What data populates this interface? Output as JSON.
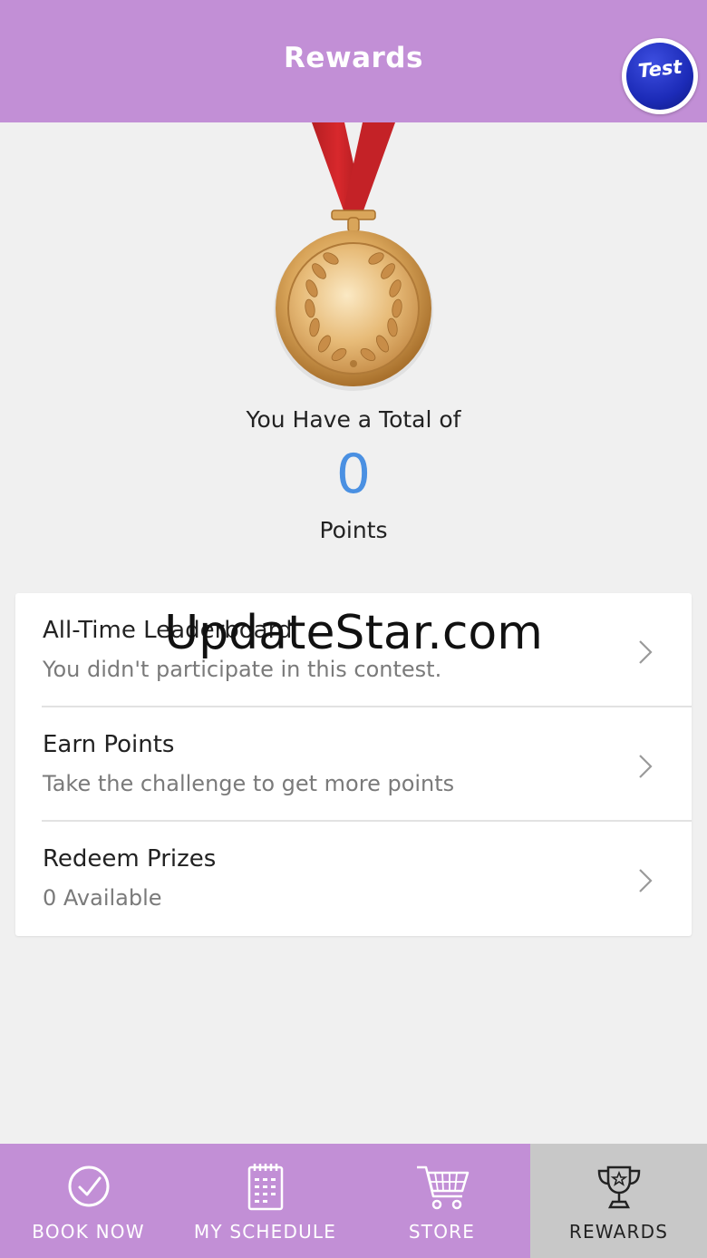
{
  "header": {
    "title": "Rewards",
    "avatar_text": "Test"
  },
  "summary": {
    "total_label": "You Have a Total of",
    "points_value": "0",
    "points_label": "Points"
  },
  "list": {
    "items": [
      {
        "title": "All-Time Leaderboard",
        "subtitle": "You didn't participate in this contest."
      },
      {
        "title": "Earn Points",
        "subtitle": "Take the challenge to get more points"
      },
      {
        "title": "Redeem Prizes",
        "subtitle": "0 Available"
      }
    ]
  },
  "watermark": "UpdateStar.com",
  "bottom_nav": {
    "items": [
      {
        "label": "BOOK NOW",
        "icon": "check-circle-icon"
      },
      {
        "label": "MY SCHEDULE",
        "icon": "calendar-icon"
      },
      {
        "label": "STORE",
        "icon": "cart-icon"
      },
      {
        "label": "REWARDS",
        "icon": "trophy-icon"
      }
    ],
    "active": "REWARDS"
  },
  "colors": {
    "header": "#c28fd6",
    "accent_points": "#4a90e2",
    "background": "#f0f0f0",
    "active_tab": "#c8c8c8"
  }
}
